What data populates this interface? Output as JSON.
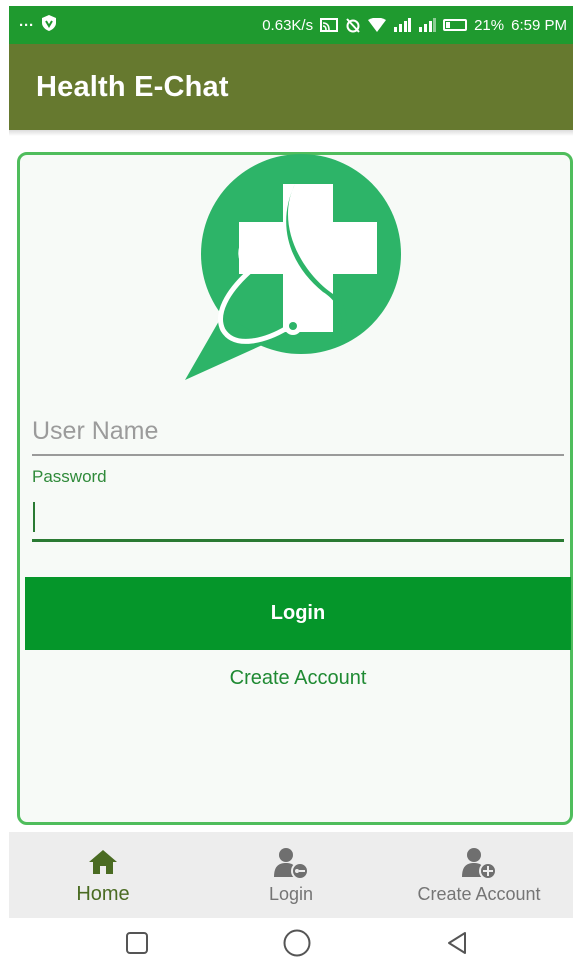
{
  "status_bar": {
    "left_dots": "···",
    "network_speed": "0.63K/s",
    "battery_percent": "21%",
    "time": "6:59 PM"
  },
  "app_bar": {
    "title": "Health E-Chat"
  },
  "login_form": {
    "username_placeholder": "User Name",
    "password_label": "Password",
    "login_button": "Login",
    "create_account_link": "Create Account"
  },
  "bottom_nav": {
    "items": [
      {
        "label": "Home",
        "icon": "home-icon",
        "active": true
      },
      {
        "label": "Login",
        "icon": "user-key-icon",
        "active": false
      },
      {
        "label": "Create Account",
        "icon": "user-add-icon",
        "active": false
      }
    ]
  },
  "system_nav": {
    "icons": [
      "recent-apps-icon",
      "home-circle-icon",
      "back-icon"
    ]
  },
  "colors": {
    "status_bar": "#1f9a2f",
    "app_bar": "#66792f",
    "primary_green": "#05962a",
    "logo_green": "#2db468",
    "card_border": "#4fbd5c"
  }
}
